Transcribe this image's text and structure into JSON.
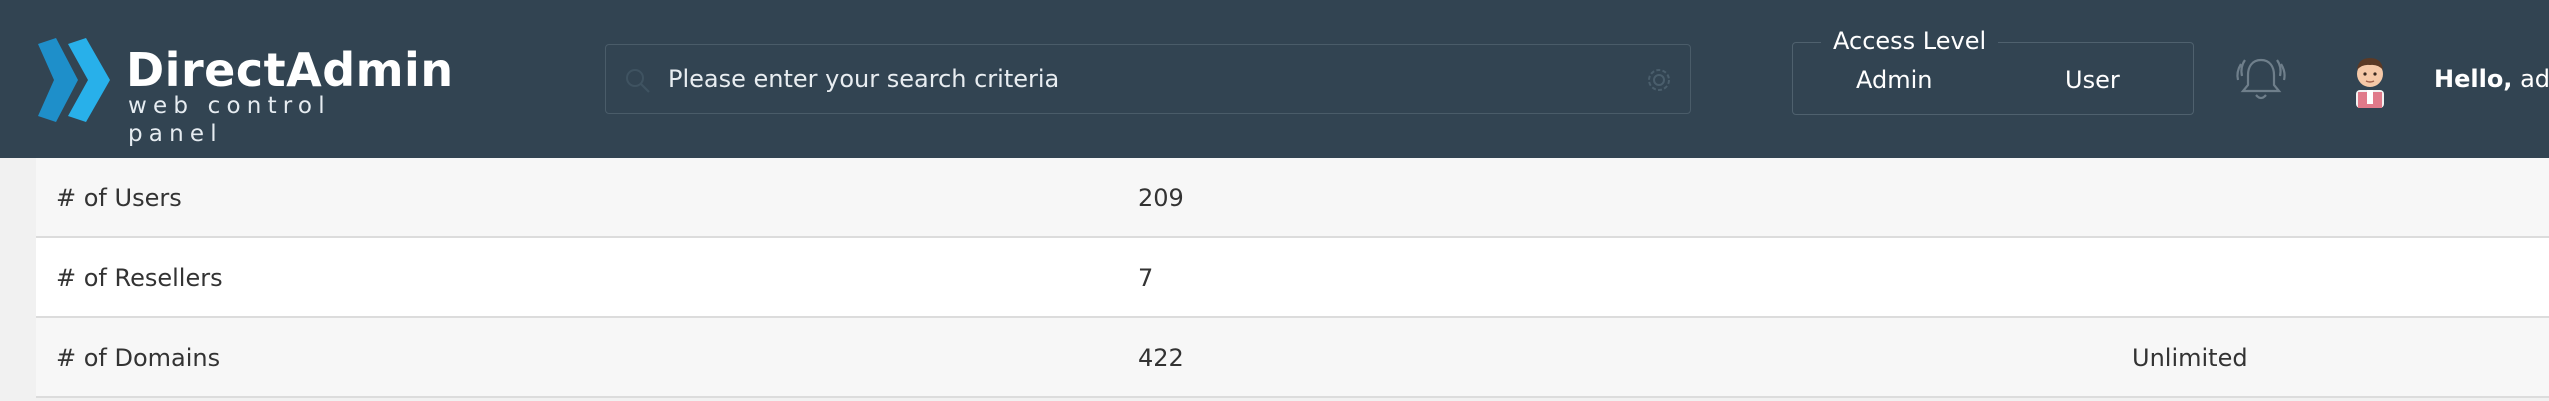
{
  "header": {
    "logo": {
      "title": "DirectAdmin",
      "subtitle": "web control panel"
    },
    "search": {
      "placeholder": "Please enter your search criteria",
      "value": ""
    },
    "access_level": {
      "legend": "Access Level",
      "options": [
        "Admin",
        "User"
      ]
    },
    "greeting": {
      "hello": "Hello,",
      "name": "adm"
    }
  },
  "stats": {
    "rows": [
      {
        "label": "# of Users",
        "value": "209",
        "limit": ""
      },
      {
        "label": "# of Resellers",
        "value": "7",
        "limit": ""
      },
      {
        "label": "# of Domains",
        "value": "422",
        "limit": "Unlimited"
      }
    ]
  },
  "colors": {
    "header_bg": "#324452",
    "logo_blue": "#1fa6e0",
    "row_odd": "#f7f7f7",
    "row_even": "#ffffff"
  },
  "icons": [
    "directadmin-logo-icon",
    "search-icon",
    "gear-icon",
    "bell-icon",
    "avatar-icon"
  ]
}
